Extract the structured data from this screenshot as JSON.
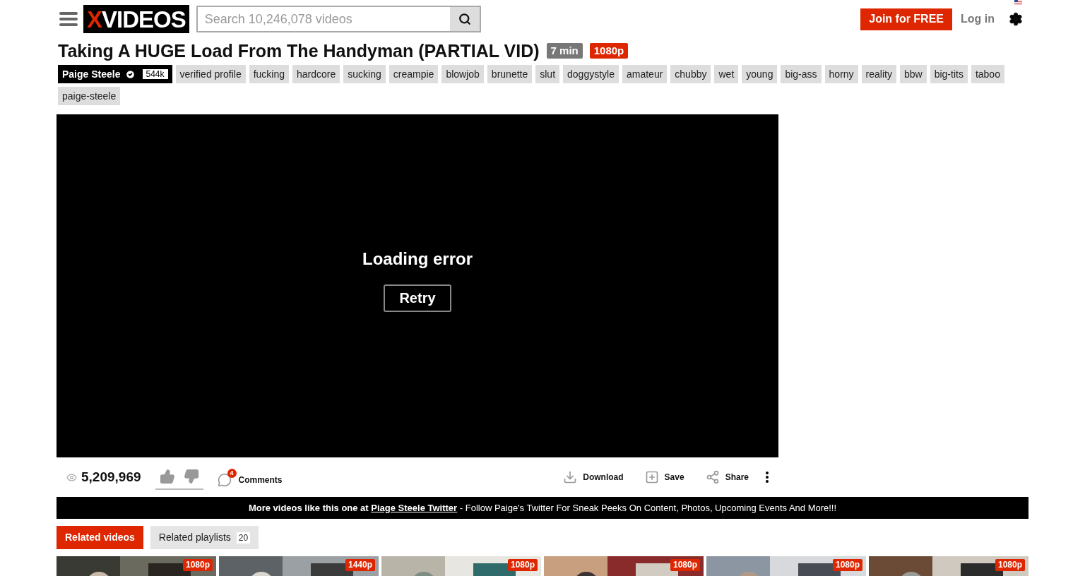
{
  "header": {
    "logo": {
      "accent": "X",
      "rest": "VIDEOS"
    },
    "search": {
      "placeholder": "Search 10,246,078 videos"
    },
    "join": "Join for FREE",
    "login": "Log in"
  },
  "video": {
    "title": "Taking A HUGE Load From The Handyman (PARTIAL VID)",
    "duration": "7 min",
    "quality": "1080p"
  },
  "uploader": {
    "name": "Paige Steele",
    "verified": true,
    "subscribers": "544k"
  },
  "tags": [
    "verified profile",
    "fucking",
    "hardcore",
    "sucking",
    "creampie",
    "blowjob",
    "brunette",
    "slut",
    "doggystyle",
    "amateur",
    "chubby",
    "wet",
    "young",
    "big-ass",
    "horny",
    "reality",
    "bbw",
    "big-tits",
    "taboo",
    "paige-steele"
  ],
  "player": {
    "message": "Loading error",
    "retry": "Retry"
  },
  "stats": {
    "views": "5,209,969",
    "comments_count": "4",
    "comments": "Comments",
    "actions": [
      {
        "kind": "download",
        "label": "Download"
      },
      {
        "kind": "save",
        "label": "Save"
      },
      {
        "kind": "share",
        "label": "Share"
      }
    ]
  },
  "promo": {
    "lead": "More videos like this one at",
    "link": "Piage Steele Twitter",
    "rest": " - Follow Paige's Twitter For Sneak Peeks On Content, Photos, Upcoming Events And More!!!"
  },
  "related_tabs": [
    {
      "label": "Related videos",
      "selected": true
    },
    {
      "label": "Related playlists",
      "count": "20",
      "selected": false
    }
  ],
  "thumbnails": [
    {
      "kind": "picture",
      "quality": "1080p"
    },
    {
      "kind": "picture",
      "quality": "1440p"
    },
    {
      "kind": "picture",
      "quality": "1080p"
    },
    {
      "kind": "picture",
      "quality": "1080p"
    },
    {
      "kind": "picture",
      "quality": "1080p"
    },
    {
      "kind": "picture",
      "quality": "1080p"
    }
  ]
}
